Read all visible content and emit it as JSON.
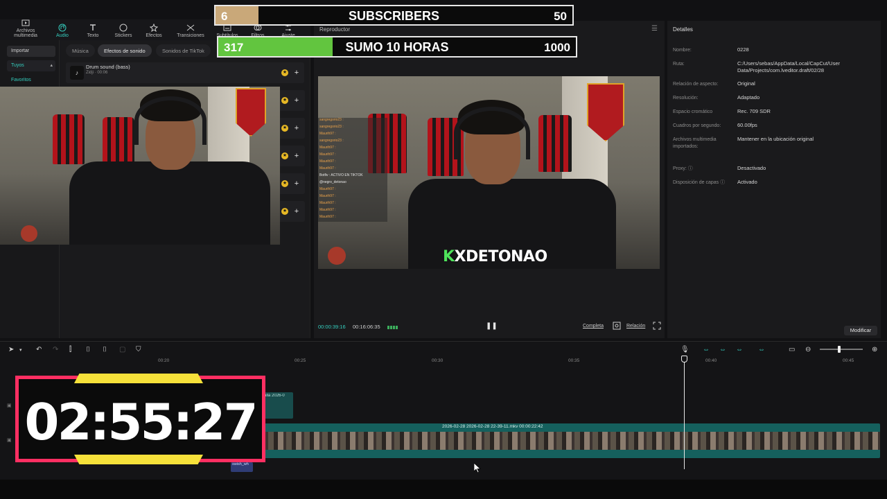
{
  "toolbar": {
    "items": [
      {
        "label": "Archivos multimedia",
        "icon": "media-icon",
        "active": false
      },
      {
        "label": "Audio",
        "icon": "audio-icon",
        "active": true
      },
      {
        "label": "Texto",
        "icon": "text-icon",
        "active": false
      },
      {
        "label": "Stickers",
        "icon": "sticker-icon",
        "active": false
      },
      {
        "label": "Efectos",
        "icon": "effects-icon",
        "active": false
      },
      {
        "label": "Transiciones",
        "icon": "transitions-icon",
        "active": false
      },
      {
        "label": "Subtítulos",
        "icon": "subtitles-icon",
        "active": false
      },
      {
        "label": "Filtros",
        "icon": "filters-icon",
        "active": false
      },
      {
        "label": "Ajuste",
        "icon": "adjust-icon",
        "active": false
      }
    ]
  },
  "sidebar": {
    "import": "Importar",
    "yours": "Tuyos",
    "favorites": "Favoritos"
  },
  "audio_tabs": {
    "music": "Música",
    "sfx": "Efectos de sonido",
    "tiktok": "Sonidos de TikTok"
  },
  "sound": {
    "name": "Drum sound (bass)",
    "meta": "Zidji · 00:06"
  },
  "player": {
    "title": "Reproductor",
    "current_time": "00:00:39:16",
    "total_time": "00:16:06:35",
    "complete_label": "Completa",
    "ratio_label": "Relación",
    "brand_k": "K",
    "brand_text": "XDETONAO"
  },
  "chat": [
    {
      "user": "sangregorio23 :",
      "w": false
    },
    {
      "user": "sangregorio23 :",
      "w": false
    },
    {
      "user": "Maurih97 :",
      "w": false
    },
    {
      "user": "sangregorio23 :",
      "w": false
    },
    {
      "user": "Maurih97 :",
      "w": false
    },
    {
      "user": "Maurih97 :",
      "w": false
    },
    {
      "user": "Maurih97 :",
      "w": false
    },
    {
      "user": "Maurih97 :",
      "w": false
    },
    {
      "user": "Botfiv : ACTIVO EN TIKTOK",
      "w": true
    },
    {
      "user": "@negro_detonao",
      "w": true
    },
    {
      "user": "Maurih97 :",
      "w": false
    },
    {
      "user": "Maurih97 :",
      "w": false
    },
    {
      "user": "Maurih97 :",
      "w": false
    },
    {
      "user": "Maurih97 :",
      "w": false
    },
    {
      "user": "Maurih97 :",
      "w": false
    }
  ],
  "details": {
    "title": "Detalles",
    "rows": [
      {
        "k": "Nombre:",
        "v": "0228"
      },
      {
        "k": "Ruta:",
        "v": "C:/Users/sebas/AppData/Local/CapCut/User Data/Projects/com.lveditor.draft/02/28"
      },
      {
        "k": "Relación de aspecto:",
        "v": "Original"
      },
      {
        "k": "Resolución:",
        "v": "Adaptado"
      },
      {
        "k": "Espacio cromático",
        "v": "Rec. 709 SDR"
      },
      {
        "k": "Cuadros por segundo:",
        "v": "60.00fps"
      },
      {
        "k": "Archivos multimedia importados:",
        "v": "Mantener en la ubicación original"
      },
      {
        "k": "Proxy: ⓘ",
        "v": "Desactivado"
      },
      {
        "k": "Disposición de capas ⓘ",
        "v": "Activado"
      }
    ],
    "modify": "Modificar"
  },
  "timeline": {
    "ticks": [
      "00:20",
      "00:25",
      "00:30",
      "00:35",
      "00:40",
      "00:45"
    ],
    "clip_small_label": "Captura de pantalla 2026-0",
    "clip_main_label": "2026-02-28   2026-02-28 22-39-11.mkv   00:00:22:42",
    "audio_label": "swish_wh",
    "zoom_fraction": 0.45
  },
  "overlay": {
    "subs_count": "6",
    "subs_label": "SUBSCRIBERS",
    "subs_goal": "50",
    "subs_progress": 0.12,
    "hours_count": "317",
    "hours_label": "SUMO 10 HORAS",
    "hours_goal": "1000",
    "hours_progress": 0.32,
    "timer": "02:55:27"
  },
  "colors": {
    "accent": "#35d0c0",
    "timer_border": "#ff2f62",
    "timer_bars": "#f6e13a",
    "hours_fill": "#62c53f",
    "subs_fill": "#c9a879"
  }
}
